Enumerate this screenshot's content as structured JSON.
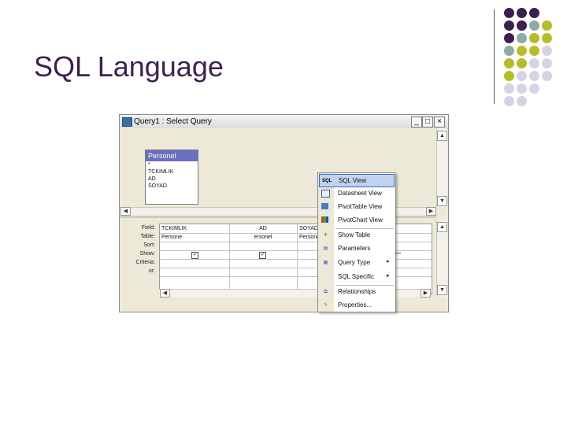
{
  "slide": {
    "title": "SQL Language",
    "accent_colors": [
      "#3d1f4f",
      "#8fa8a8",
      "#b8bc2a",
      "#d4d4e6"
    ]
  },
  "window": {
    "title": "Query1 : Select Query",
    "min_label": "_",
    "max_label": "□",
    "close_label": "×"
  },
  "table_box": {
    "name": "Personel",
    "fields": [
      "*",
      "TCKIMLIK",
      "AD",
      "SOYAD"
    ]
  },
  "grid": {
    "row_labels": [
      "Field:",
      "Table:",
      "Sort:",
      "Show:",
      "Criteria:",
      "or:"
    ],
    "columns": [
      {
        "field": "TCKIMLIK",
        "table": "Persone",
        "show": true
      },
      {
        "field": "AD",
        "table": "ersonel",
        "show": true
      },
      {
        "field": "SOYAD",
        "table": "Persone",
        "show": false
      }
    ]
  },
  "context_menu": {
    "items": [
      {
        "label": "SQL View",
        "icon": "sql-icon",
        "highlighted": true
      },
      {
        "label": "Datasheet View",
        "icon": "datasheet-icon"
      },
      {
        "label": "PivotTable View",
        "icon": "pivottable-icon"
      },
      {
        "label": "PivotChart View",
        "icon": "pivotchart-icon"
      },
      {
        "label": "Show Table",
        "icon": "show-table-icon"
      },
      {
        "label": "Parameters",
        "icon": "parameters-icon"
      },
      {
        "label": "Query Type",
        "icon": "query-type-icon",
        "submenu": true
      },
      {
        "label": "SQL Specific",
        "icon": "",
        "submenu": true
      },
      {
        "label": "Relationships",
        "icon": "relationships-icon"
      },
      {
        "label": "Properties...",
        "icon": "properties-icon"
      }
    ]
  }
}
